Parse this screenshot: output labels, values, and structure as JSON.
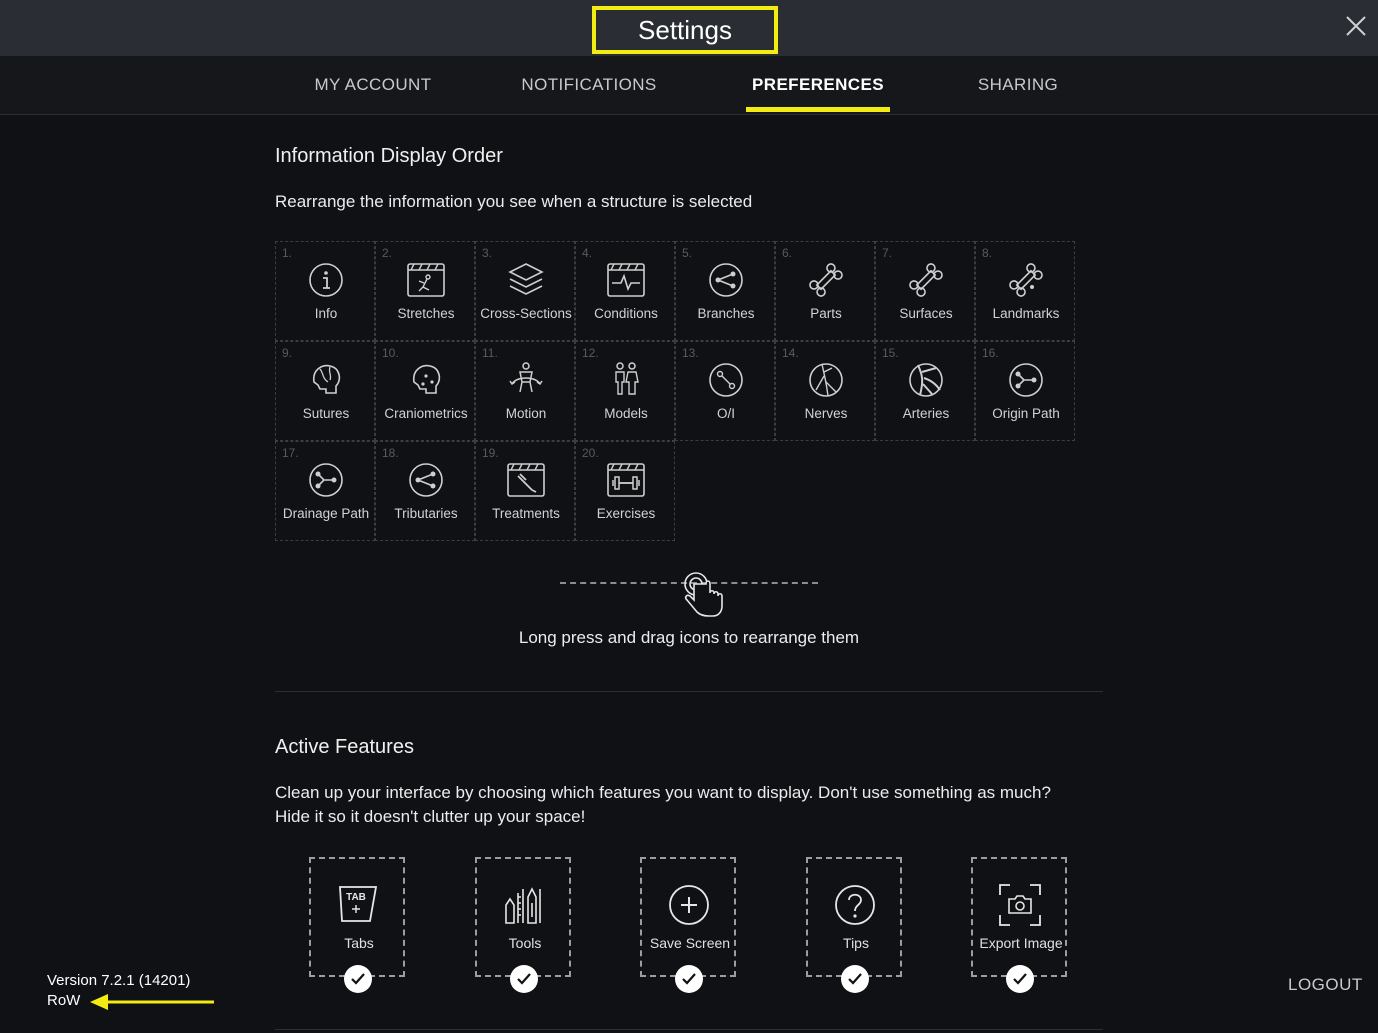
{
  "window": {
    "title": "Settings"
  },
  "tabs": [
    {
      "label": "MY ACCOUNT",
      "active": false
    },
    {
      "label": "NOTIFICATIONS",
      "active": false
    },
    {
      "label": "PREFERENCES",
      "active": true
    },
    {
      "label": "SHARING",
      "active": false
    }
  ],
  "display_order": {
    "heading": "Information Display Order",
    "description": "Rearrange the information you see when a structure is selected",
    "items": [
      {
        "num": "1.",
        "label": "Info",
        "icon": "info-icon"
      },
      {
        "num": "2.",
        "label": "Stretches",
        "icon": "stretches-icon"
      },
      {
        "num": "3.",
        "label": "Cross-Sections",
        "icon": "layers-icon"
      },
      {
        "num": "4.",
        "label": "Conditions",
        "icon": "heartbeat-icon"
      },
      {
        "num": "5.",
        "label": "Branches",
        "icon": "branches-icon"
      },
      {
        "num": "6.",
        "label": "Parts",
        "icon": "bone-icon"
      },
      {
        "num": "7.",
        "label": "Surfaces",
        "icon": "bone-icon"
      },
      {
        "num": "8.",
        "label": "Landmarks",
        "icon": "bone-icon"
      },
      {
        "num": "9.",
        "label": "Sutures",
        "icon": "skull-icon"
      },
      {
        "num": "10.",
        "label": "Craniometrics",
        "icon": "skull-icon"
      },
      {
        "num": "11.",
        "label": "Motion",
        "icon": "motion-icon"
      },
      {
        "num": "12.",
        "label": "Models",
        "icon": "people-icon"
      },
      {
        "num": "13.",
        "label": "O/I",
        "icon": "origin-insertion-icon"
      },
      {
        "num": "14.",
        "label": "Nerves",
        "icon": "nerves-icon"
      },
      {
        "num": "15.",
        "label": "Arteries",
        "icon": "arteries-icon"
      },
      {
        "num": "16.",
        "label": "Origin Path",
        "icon": "path-icon"
      },
      {
        "num": "17.",
        "label": "Drainage Path",
        "icon": "path-icon"
      },
      {
        "num": "18.",
        "label": "Tributaries",
        "icon": "branches-icon"
      },
      {
        "num": "19.",
        "label": "Treatments",
        "icon": "treatment-icon"
      },
      {
        "num": "20.",
        "label": "Exercises",
        "icon": "dumbbell-icon"
      }
    ],
    "hint": "Long press and drag icons to rearrange them"
  },
  "active_features": {
    "heading": "Active Features",
    "description_line1": "Clean up your interface by choosing which features you want to display. Don't use something as much?",
    "description_line2": "Hide it so it doesn't clutter up your space!",
    "items": [
      {
        "label": "Tabs",
        "icon": "tabs-icon",
        "checked": true
      },
      {
        "label": "Tools",
        "icon": "tools-icon",
        "checked": true
      },
      {
        "label": "Save Screen",
        "icon": "plus-circle-icon",
        "checked": true
      },
      {
        "label": "Tips",
        "icon": "question-icon",
        "checked": true
      },
      {
        "label": "Export Image",
        "icon": "camera-icon",
        "checked": true
      }
    ]
  },
  "footer": {
    "version": "Version 7.2.1 (14201)",
    "region": "RoW",
    "logout": "LOGOUT"
  },
  "colors": {
    "accent": "#f2ec12",
    "background": "#0f1115",
    "header": "#2a2d33"
  }
}
